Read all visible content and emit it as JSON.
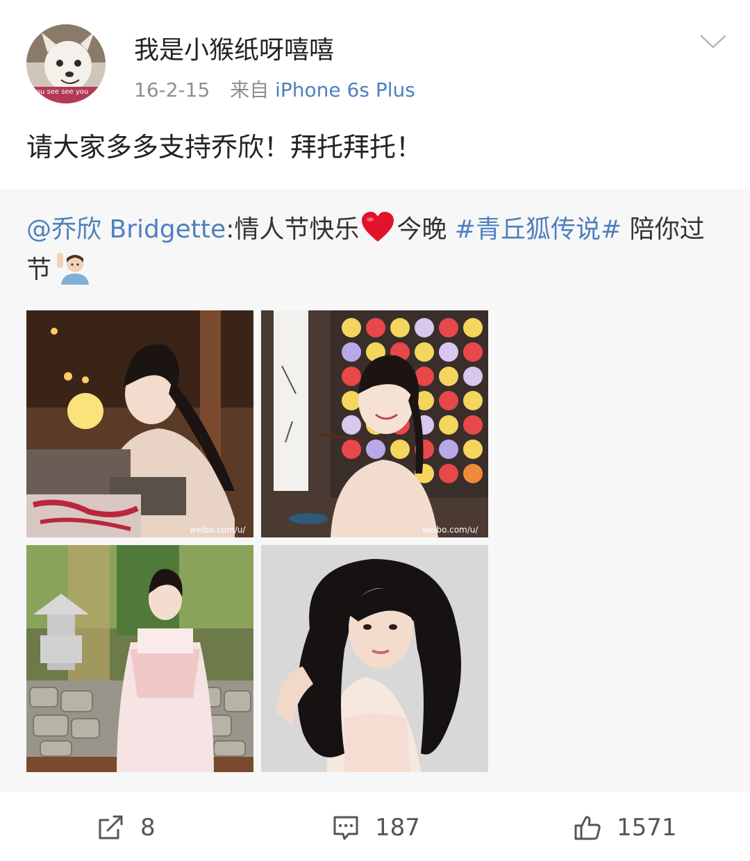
{
  "post": {
    "username": "我是小猴纸呀嘻嘻",
    "date": "16-2-15",
    "source_prefix": "来自",
    "source_device": "iPhone 6s Plus",
    "text": "请大家多多支持乔欣！拜托拜托！"
  },
  "avatar": {
    "overlay_text": "you see see you"
  },
  "repost": {
    "mention": "@乔欣 Bridgette",
    "text_before_emoji": ":情人节快乐",
    "text_after_emoji": "今晚",
    "hashtag": "#青丘狐传说#",
    "text_tail": "陪你过节",
    "emojis": [
      "heart-emoji",
      "person-raising-hand-emoji"
    ],
    "images": [
      {
        "watermark": "weibo.com/u/"
      },
      {
        "watermark": "weibo.com/u/"
      },
      {
        "watermark": ""
      },
      {
        "watermark": ""
      }
    ]
  },
  "actions": {
    "share_count": "8",
    "comment_count": "187",
    "like_count": "1571"
  },
  "colors": {
    "link": "#4f7fbf",
    "text": "#222222",
    "meta": "#8f8f8f",
    "repost_bg": "#f7f7f7"
  },
  "icons": [
    "chevron-down-icon",
    "share-icon",
    "comment-icon",
    "like-icon",
    "weibo-logo-icon"
  ]
}
